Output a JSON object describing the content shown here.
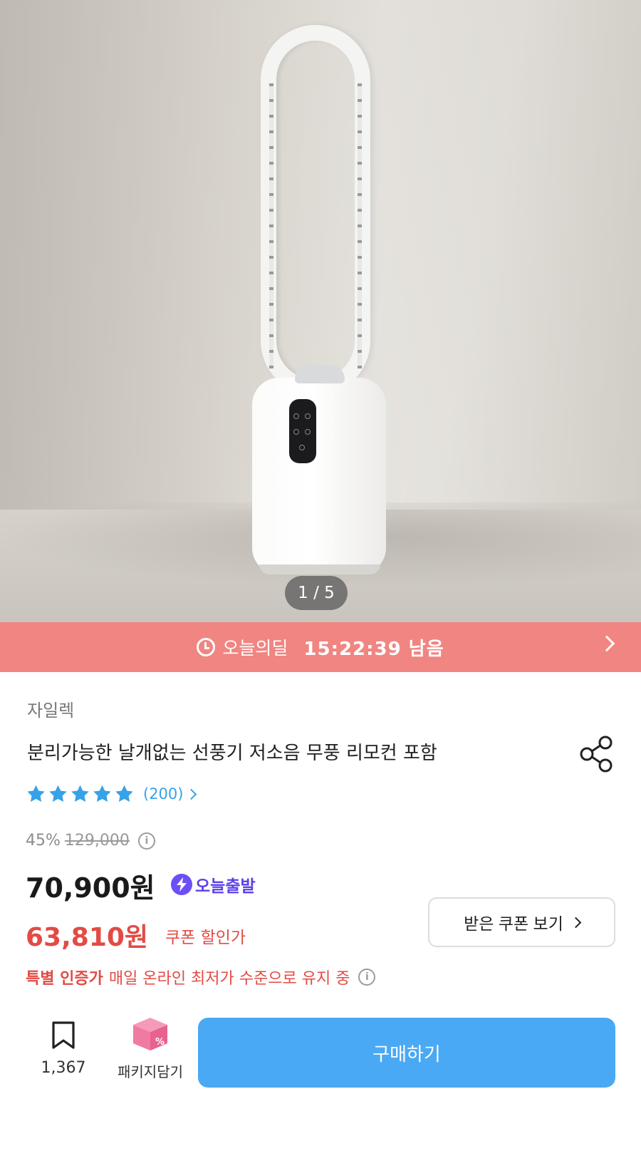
{
  "gallery": {
    "pager": "1 / 5"
  },
  "deal": {
    "label": "오늘의딜",
    "time_left": "15:22:39 남음"
  },
  "product": {
    "brand": "자일렉",
    "title": "분리가능한 날개없는 선풍기 저소음 무풍 리모컨 포함",
    "rating_stars": 5,
    "review_count": "(200)",
    "discount_percent": "45%",
    "original_price": "129,000",
    "price": "70,900원",
    "delivery_badge": "오늘출발",
    "coupon_price": "63,810원",
    "coupon_label": "쿠폰 할인가",
    "coupon_button": "받은 쿠폰 보기",
    "special_label": "특별 인증가",
    "special_desc": "매일 온라인 최저가 수준으로 유지 중"
  },
  "bottom_bar": {
    "bookmark_count": "1,367",
    "package_label": "패키지담기",
    "buy_label": "구매하기"
  },
  "colors": {
    "deal_banner": "#f08582",
    "accent_blue": "#49a9f4",
    "sale_red": "#e24b44",
    "delivery_purple": "#6c4ff6",
    "star_blue": "#36a2e8"
  }
}
